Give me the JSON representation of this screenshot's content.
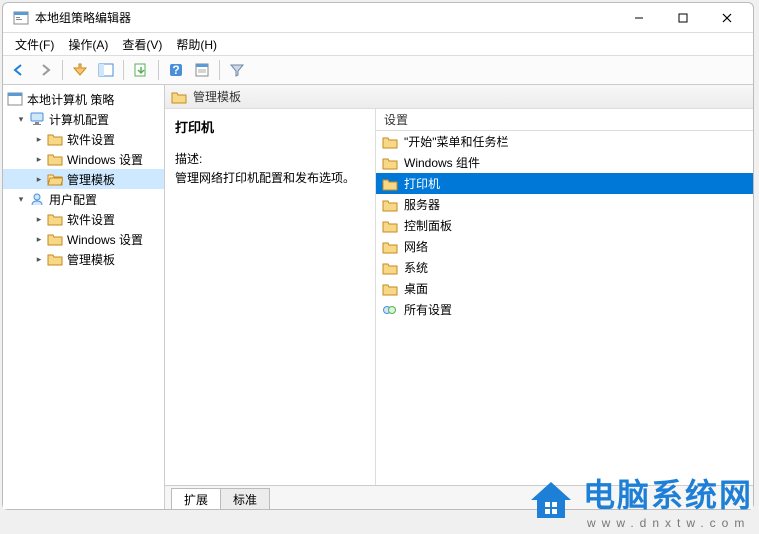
{
  "window": {
    "title": "本地组策略编辑器"
  },
  "menu": {
    "file": "文件(F)",
    "action": "操作(A)",
    "view": "查看(V)",
    "help": "帮助(H)"
  },
  "tree": {
    "root": "本地计算机 策略",
    "computer": {
      "label": "计算机配置",
      "software": "软件设置",
      "windows": "Windows 设置",
      "templates": "管理模板"
    },
    "user": {
      "label": "用户配置",
      "software": "软件设置",
      "windows": "Windows 设置",
      "templates": "管理模板"
    }
  },
  "detail": {
    "header": "管理模板",
    "topic": "打印机",
    "desc_label": "描述:",
    "desc_text": "管理网络打印机配置和发布选项。",
    "column": "设置",
    "items": [
      {
        "label": "\"开始\"菜单和任务栏",
        "icon": "folder"
      },
      {
        "label": "Windows 组件",
        "icon": "folder"
      },
      {
        "label": "打印机",
        "icon": "folder",
        "selected": true
      },
      {
        "label": "服务器",
        "icon": "folder"
      },
      {
        "label": "控制面板",
        "icon": "folder"
      },
      {
        "label": "网络",
        "icon": "folder"
      },
      {
        "label": "系统",
        "icon": "folder"
      },
      {
        "label": "桌面",
        "icon": "folder"
      },
      {
        "label": "所有设置",
        "icon": "settings"
      }
    ],
    "tabs": {
      "extended": "扩展",
      "standard": "标准"
    }
  },
  "watermark": {
    "brand": "电脑系统网",
    "url": "www.dnxtw.com"
  }
}
